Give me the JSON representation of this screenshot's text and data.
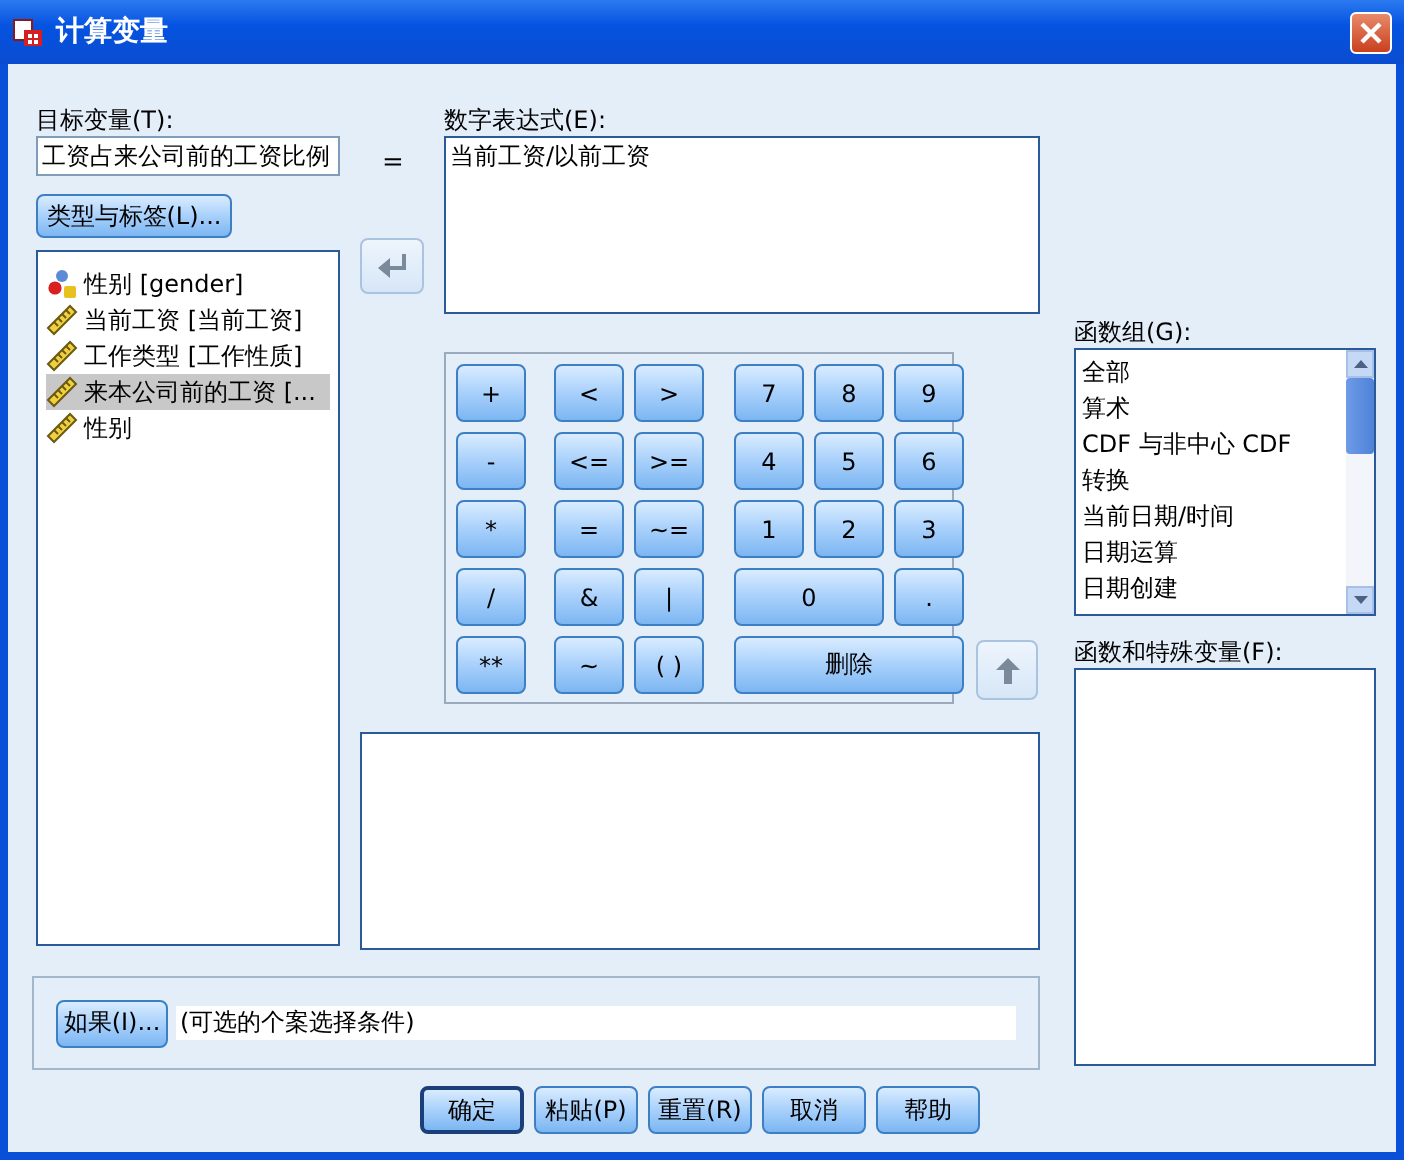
{
  "window": {
    "title": "计算变量"
  },
  "target": {
    "label": "目标变量(T):",
    "value": "工资占来公司前的工资比例"
  },
  "equals": "=",
  "type_label_button": "类型与标签(L)...",
  "variables": [
    {
      "name": "性别 [gender]",
      "kind": "nominal",
      "selected": false
    },
    {
      "name": "当前工资 [当前工资]",
      "kind": "scale",
      "selected": false
    },
    {
      "name": "工作类型 [工作性质]",
      "kind": "scale",
      "selected": false
    },
    {
      "name": "来本公司前的工资 [...",
      "kind": "scale",
      "selected": true
    },
    {
      "name": "性别",
      "kind": "scale",
      "selected": false
    }
  ],
  "expression": {
    "label": "数字表达式(E):",
    "value": "当前工资/以前工资"
  },
  "keypad": [
    [
      {
        "label": "+",
        "kind": "single"
      },
      {
        "label": "<",
        "kind": "single"
      },
      {
        "label": ">",
        "kind": "single"
      },
      {
        "label": "7",
        "kind": "single"
      },
      {
        "label": "8",
        "kind": "single"
      },
      {
        "label": "9",
        "kind": "single"
      }
    ],
    [
      {
        "label": "-",
        "kind": "single"
      },
      {
        "label": "<=",
        "kind": "single"
      },
      {
        "label": ">=",
        "kind": "single"
      },
      {
        "label": "4",
        "kind": "single"
      },
      {
        "label": "5",
        "kind": "single"
      },
      {
        "label": "6",
        "kind": "single"
      }
    ],
    [
      {
        "label": "*",
        "kind": "single"
      },
      {
        "label": "=",
        "kind": "single"
      },
      {
        "label": "~=",
        "kind": "single"
      },
      {
        "label": "1",
        "kind": "single"
      },
      {
        "label": "2",
        "kind": "single"
      },
      {
        "label": "3",
        "kind": "single"
      }
    ],
    [
      {
        "label": "/",
        "kind": "single"
      },
      {
        "label": "&",
        "kind": "single"
      },
      {
        "label": "|",
        "kind": "single"
      },
      {
        "label": "0",
        "kind": "double"
      },
      {
        "label": ".",
        "kind": "single"
      }
    ],
    [
      {
        "label": "**",
        "kind": "single"
      },
      {
        "label": "~",
        "kind": "single"
      },
      {
        "label": "( )",
        "kind": "single"
      },
      {
        "label": "删除",
        "kind": "triple"
      }
    ]
  ],
  "function_group": {
    "label": "函数组(G):",
    "items": [
      "全部",
      "算术",
      "CDF 与非中心 CDF",
      "转换",
      "当前日期/时间",
      "日期运算",
      "日期创建"
    ]
  },
  "functions": {
    "label": "函数和特殊变量(F):"
  },
  "if_button": "如果(I)...",
  "condition": "(可选的个案选择条件)",
  "buttons": [
    {
      "label": "确定",
      "default": true
    },
    {
      "label": "粘贴(P)",
      "default": false
    },
    {
      "label": "重置(R)",
      "default": false
    },
    {
      "label": "取消",
      "default": false
    },
    {
      "label": "帮助",
      "default": false
    }
  ]
}
